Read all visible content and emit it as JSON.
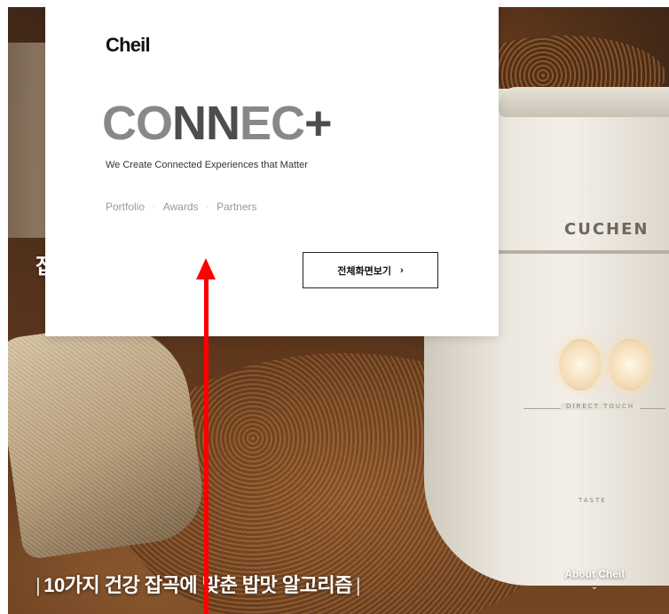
{
  "hero": {
    "cooker_brand": "CUCHEN",
    "cooker_touch_label": "DIRECT TOUCH",
    "cooker_taste_label": "TASTE",
    "partial_headline": "잡",
    "caption": "10가지 건강 잡곡에 맞춘 밥맛 알고리즘"
  },
  "card": {
    "logo": "Cheil",
    "connect_part1": "CO",
    "connect_part2": "NN",
    "connect_part3": "EC",
    "connect_plus": "+",
    "tagline": "We Create Connected Experiences that Matter",
    "links": [
      "Portfolio",
      "Awards",
      "Partners"
    ],
    "separator": "·",
    "fullscreen_button": "전체화면보기",
    "button_chevron": "›"
  },
  "about": {
    "label": "About Cheil",
    "chevron": "⌄"
  },
  "colors": {
    "annotation_arrow": "#ff0000",
    "card_background": "#ffffff"
  }
}
